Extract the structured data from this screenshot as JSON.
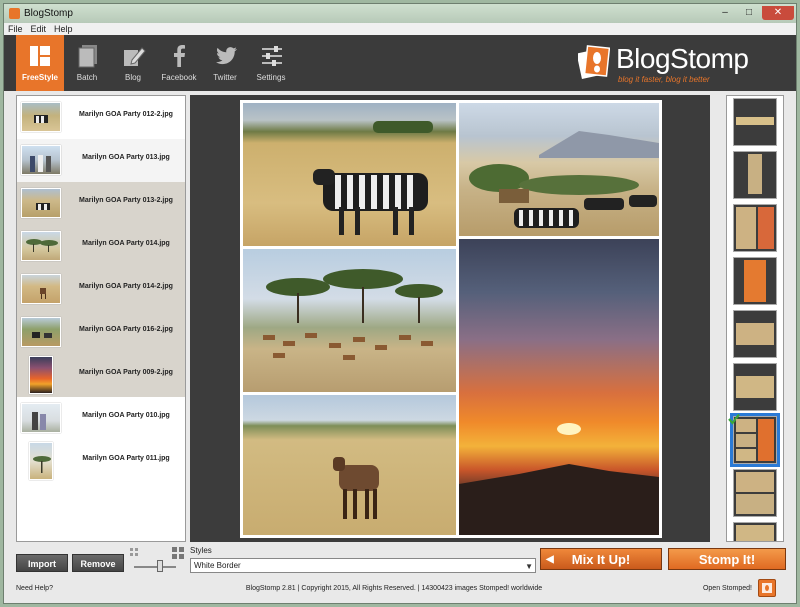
{
  "window": {
    "title": "BlogStomp",
    "minimize": "–",
    "maximize": "□",
    "close": "✕"
  },
  "menu": [
    "File",
    "Edit",
    "Help"
  ],
  "toolbar": {
    "tools": [
      {
        "label": "FreeStyle",
        "icon": "freestyle-icon",
        "active": true
      },
      {
        "label": "Batch",
        "icon": "batch-icon",
        "active": false
      },
      {
        "label": "Blog",
        "icon": "blog-icon",
        "active": false
      },
      {
        "label": "Facebook",
        "icon": "facebook-icon",
        "active": false
      },
      {
        "label": "Twitter",
        "icon": "twitter-icon",
        "active": false
      },
      {
        "label": "Settings",
        "icon": "settings-icon",
        "active": false
      }
    ]
  },
  "brand": {
    "name": "BlogStomp",
    "tagline": "blog it faster, blog it better"
  },
  "files": [
    {
      "name": "Marilyn GOA Party 012-2.jpg",
      "selected": false
    },
    {
      "name": "Marilyn GOA Party 013.jpg",
      "selected": false
    },
    {
      "name": "Marilyn GOA Party 013-2.jpg",
      "selected": true
    },
    {
      "name": "Marilyn GOA Party 014.jpg",
      "selected": true
    },
    {
      "name": "Marilyn GOA Party 014-2.jpg",
      "selected": true
    },
    {
      "name": "Marilyn GOA Party 016-2.jpg",
      "selected": true
    },
    {
      "name": "Marilyn GOA Party 009-2.jpg",
      "selected": true
    },
    {
      "name": "Marilyn GOA Party 010.jpg",
      "selected": false
    },
    {
      "name": "Marilyn GOA Party 011.jpg",
      "selected": false
    }
  ],
  "controls": {
    "import_label": "Import",
    "remove_label": "Remove",
    "styles_label": "Styles",
    "style_value": "White Border",
    "mix_label": "Mix It Up!",
    "stomp_label": "Stomp It!"
  },
  "status": {
    "need_help": "Need Help?",
    "copyright": "BlogStomp 2.81 | Copyright 2015, All Rights Reserved. | 14300423 images Stomped! worldwide",
    "open_stomped": "Open Stomped!"
  },
  "colors": {
    "accent": "#e8752a",
    "toolbar": "#3b3b3b",
    "selection": "#2a7ad6"
  }
}
